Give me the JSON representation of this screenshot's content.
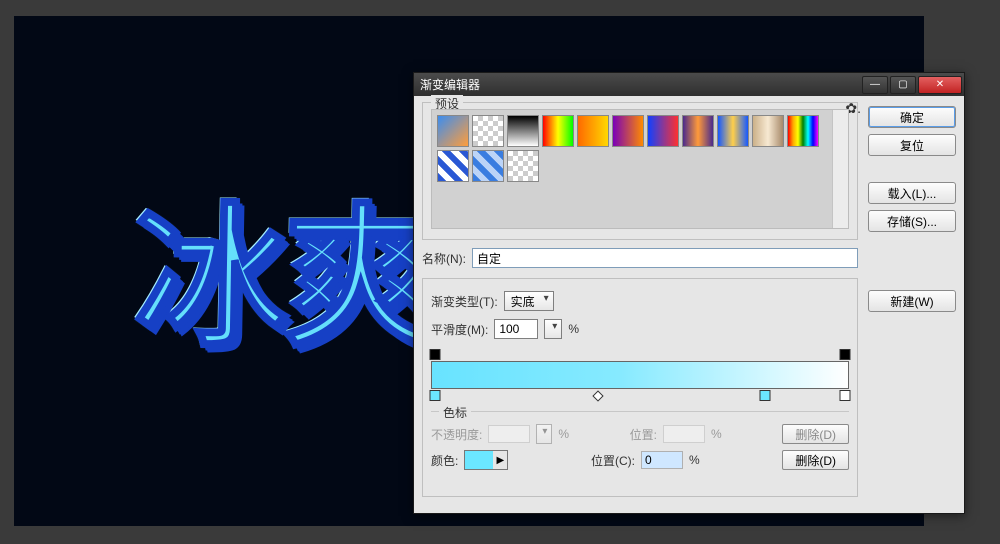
{
  "canvas": {
    "text": "冰爽"
  },
  "dialog": {
    "title": "渐变编辑器",
    "presets_label": "预设",
    "name_label": "名称(N):",
    "name_value": "自定",
    "type_label": "渐变类型(T):",
    "type_value": "实底",
    "smooth_label": "平滑度(M):",
    "smooth_value": "100",
    "percent": "%",
    "stops_label": "色标",
    "opacity_label": "不透明度:",
    "opacity_value": "",
    "opacity_pos_label": "位置:",
    "opacity_pos_value": "",
    "opacity_delete": "删除(D)",
    "color_label": "颜色:",
    "color_pos_label": "位置(C):",
    "color_pos_value": "0",
    "color_delete": "删除(D)"
  },
  "buttons": {
    "ok": "确定",
    "reset": "复位",
    "load": "载入(L)...",
    "save": "存储(S)...",
    "new": "新建(W)"
  },
  "window": {
    "min": "—",
    "max": "▢",
    "close": "✕"
  },
  "gradient": {
    "stops": [
      {
        "pos": 0,
        "color": "#68e3ff"
      },
      {
        "pos": 80,
        "color": "#c9f6ff"
      },
      {
        "pos": 100,
        "color": "#ffffff"
      }
    ],
    "opacity_stops": [
      {
        "pos": 0,
        "opacity": 100
      },
      {
        "pos": 100,
        "opacity": 100
      }
    ]
  }
}
